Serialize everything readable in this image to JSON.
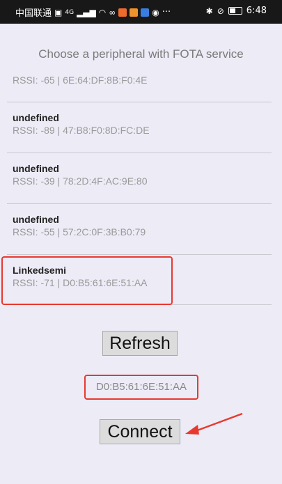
{
  "status_bar": {
    "carrier": "中国联通",
    "signal_text": "4G",
    "time": "6:48",
    "more": "···",
    "bluetooth": "✱",
    "mute_icon": "⊘"
  },
  "heading": "Choose a peripheral with FOTA service",
  "devices": [
    {
      "name": "",
      "info": "RSSI: -65 | 6E:64:DF:8B:F0:4E"
    },
    {
      "name": "undefined",
      "info": "RSSI: -89 | 47:B8:F0:8D:FC:DE"
    },
    {
      "name": "undefined",
      "info": "RSSI: -39 | 78:2D:4F:AC:9E:80"
    },
    {
      "name": "undefined",
      "info": "RSSI: -55 | 57:2C:0F:3B:B0:79"
    },
    {
      "name": "Linkedsemi",
      "info": "RSSI: -71 | D0:B5:61:6E:51:AA"
    }
  ],
  "buttons": {
    "refresh": "Refresh",
    "connect": "Connect"
  },
  "selected_address": "D0:B5:61:6E:51:AA",
  "colors": {
    "annotation_red": "#e8392f",
    "background": "#ecebf6"
  }
}
